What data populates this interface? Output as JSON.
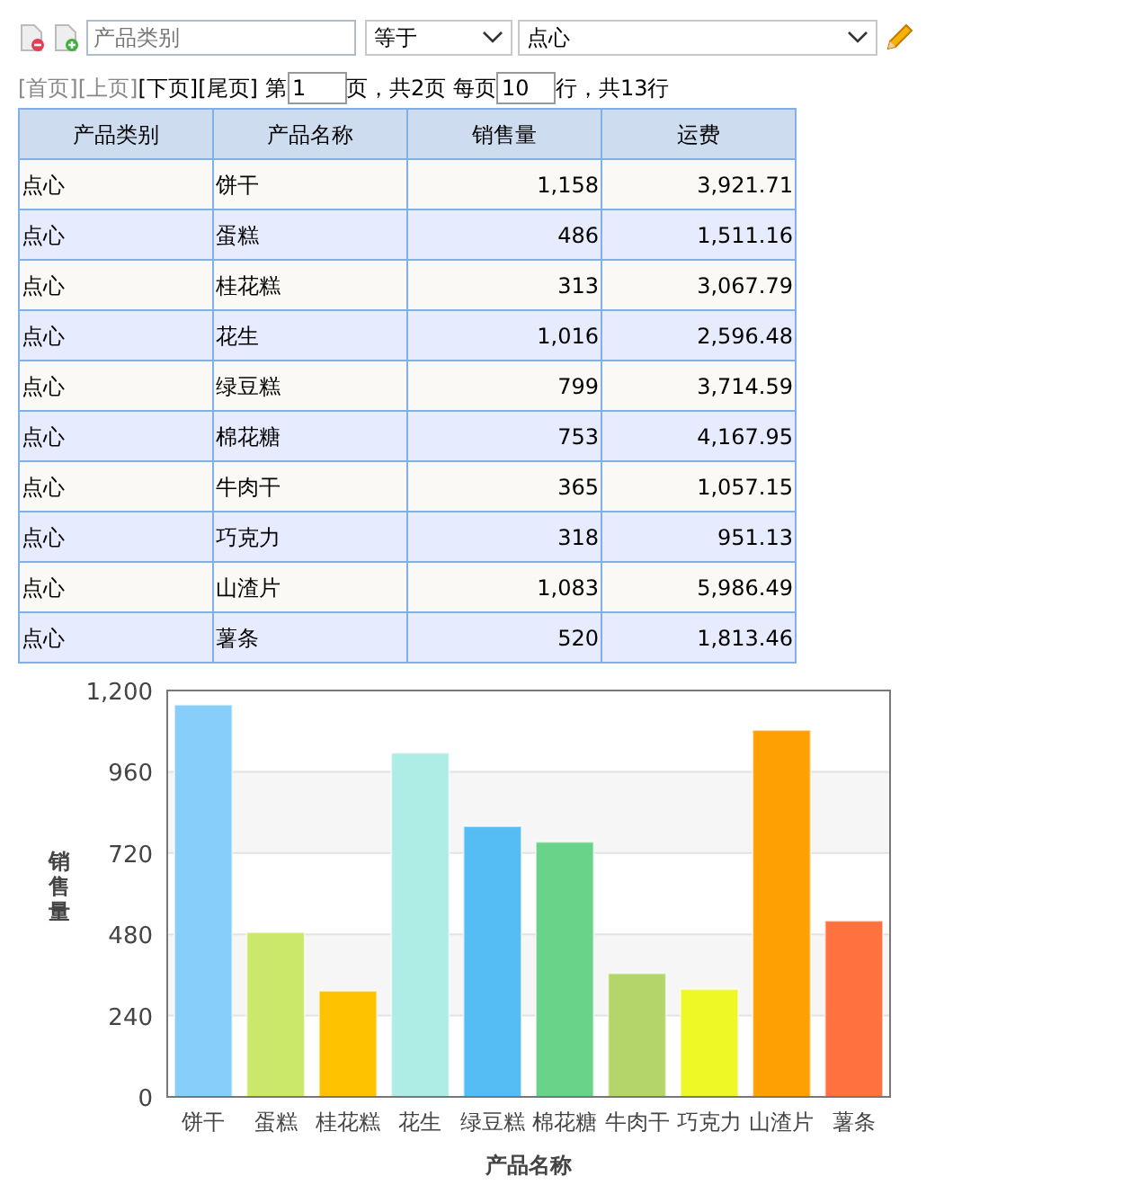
{
  "filter": {
    "field_placeholder": "产品类别",
    "operator": "等于",
    "value": "点心"
  },
  "pager": {
    "links": [
      {
        "label": "[首页]",
        "disabled": true
      },
      {
        "label": "[上页]",
        "disabled": true
      },
      {
        "label": "[下页]",
        "disabled": false
      },
      {
        "label": "[尾页]",
        "disabled": false
      }
    ],
    "page_prefix": "第",
    "page": "1",
    "page_middle": "页，共2页 每页",
    "per_page": "10",
    "per_page_suffix": "行，共13行"
  },
  "table": {
    "columns": [
      "产品类别",
      "产品名称",
      "销售量",
      "运费"
    ],
    "rows": [
      [
        "点心",
        "饼干",
        "1,158",
        "3,921.71"
      ],
      [
        "点心",
        "蛋糕",
        "486",
        "1,511.16"
      ],
      [
        "点心",
        "桂花糕",
        "313",
        "3,067.79"
      ],
      [
        "点心",
        "花生",
        "1,016",
        "2,596.48"
      ],
      [
        "点心",
        "绿豆糕",
        "799",
        "3,714.59"
      ],
      [
        "点心",
        "棉花糖",
        "753",
        "4,167.95"
      ],
      [
        "点心",
        "牛肉干",
        "365",
        "1,057.15"
      ],
      [
        "点心",
        "巧克力",
        "318",
        "951.13"
      ],
      [
        "点心",
        "山渣片",
        "1,083",
        "5,986.49"
      ],
      [
        "点心",
        "薯条",
        "520",
        "1,813.46"
      ]
    ]
  },
  "chart_data": {
    "type": "bar",
    "xlabel": "产品名称",
    "ylabel": "销售量",
    "categories": [
      "饼干",
      "蛋糕",
      "桂花糕",
      "花生",
      "绿豆糕",
      "棉花糖",
      "牛肉干",
      "巧克力",
      "山渣片",
      "薯条"
    ],
    "values": [
      1158,
      486,
      313,
      1016,
      799,
      753,
      365,
      318,
      1083,
      520
    ],
    "grid": true,
    "colors": [
      "#87cefa",
      "#cbe86b",
      "#fec200",
      "#aeede5",
      "#56bcf4",
      "#68d389",
      "#b4d56a",
      "#eef826",
      "#fea002",
      "#ff7240"
    ],
    "ylim": [
      0,
      1200
    ],
    "yticks": [
      {
        "value": 0,
        "label": "0"
      },
      {
        "value": 240,
        "label": "240"
      },
      {
        "value": 480,
        "label": "480"
      },
      {
        "value": 720,
        "label": "720"
      },
      {
        "value": 960,
        "label": "960"
      },
      {
        "value": 1200,
        "label": "1,200"
      }
    ]
  }
}
